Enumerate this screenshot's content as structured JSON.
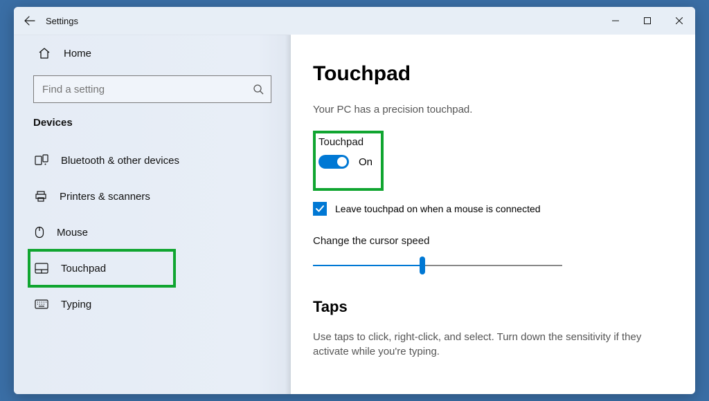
{
  "window": {
    "title": "Settings"
  },
  "sidebar": {
    "home_label": "Home",
    "search_placeholder": "Find a setting",
    "section_label": "Devices",
    "items": [
      {
        "label": "Bluetooth & other devices"
      },
      {
        "label": "Printers & scanners"
      },
      {
        "label": "Mouse"
      },
      {
        "label": "Touchpad"
      },
      {
        "label": "Typing"
      }
    ]
  },
  "content": {
    "title": "Touchpad",
    "subtitle": "Your PC has a precision touchpad.",
    "toggle": {
      "label": "Touchpad",
      "state_label": "On",
      "on": true
    },
    "checkbox": {
      "label": "Leave touchpad on when a mouse is connected",
      "checked": true
    },
    "slider": {
      "label": "Change the cursor speed",
      "value": 0.44
    },
    "section2_title": "Taps",
    "section2_text": "Use taps to click, right-click, and select. Turn down the sensitivity if they activate while you're typing."
  }
}
